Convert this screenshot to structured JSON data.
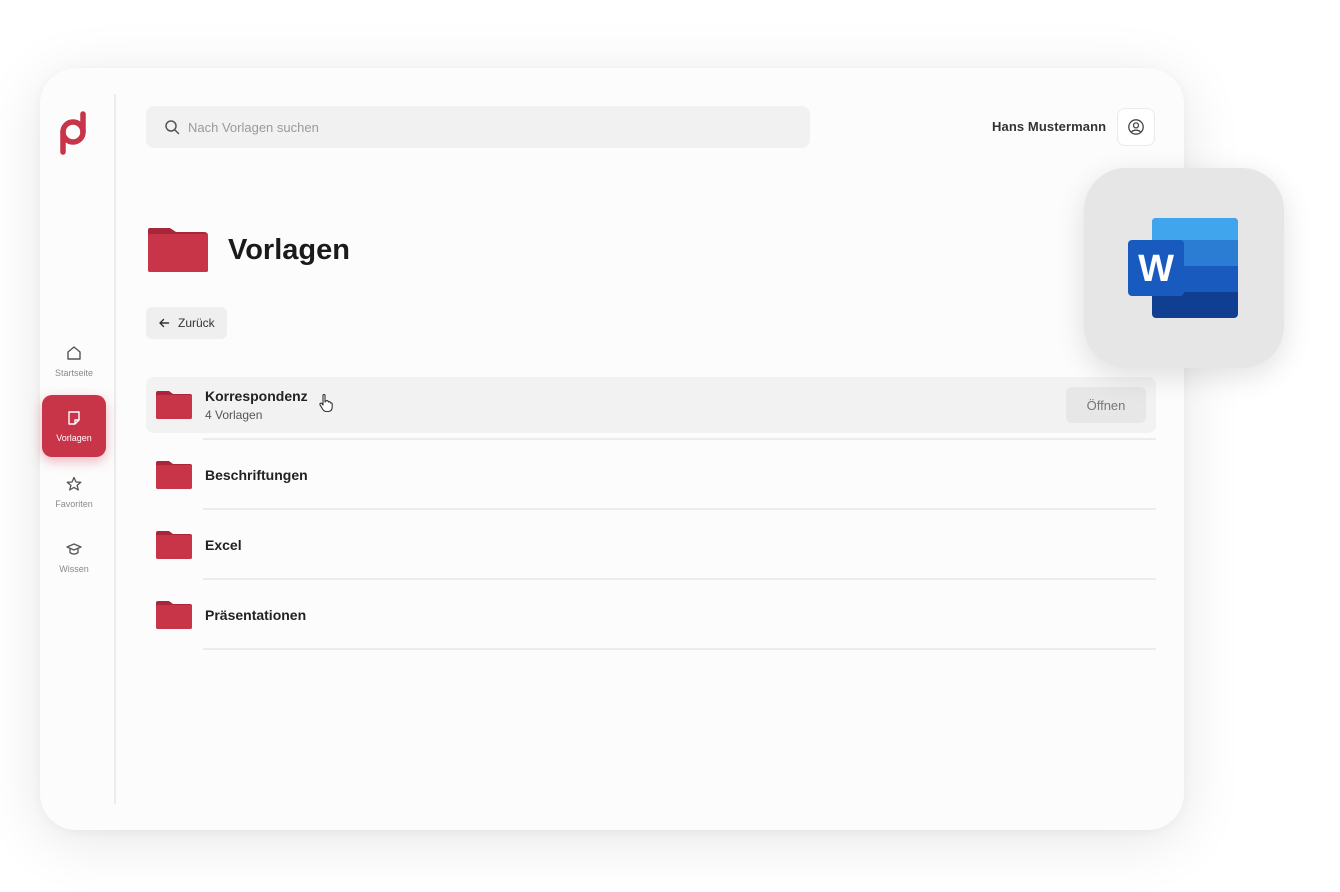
{
  "app": {
    "brand_color": "#c83448"
  },
  "sidebar": {
    "items": [
      {
        "label": "Startseite",
        "icon": "home-icon",
        "active": false
      },
      {
        "label": "Vorlagen",
        "icon": "template-icon",
        "active": true
      },
      {
        "label": "Favoriten",
        "icon": "star-icon",
        "active": false
      },
      {
        "label": "Wissen",
        "icon": "graduation-cap-icon",
        "active": false
      }
    ]
  },
  "header": {
    "search_placeholder": "Nach Vorlagen suchen",
    "user_name": "Hans Mustermann"
  },
  "page": {
    "title": "Vorlagen",
    "back_label": "Zurück"
  },
  "folders": [
    {
      "title": "Korrespondenz",
      "subtitle": "4 Vorlagen",
      "action_label": "Öffnen"
    },
    {
      "title": "Beschriftungen"
    },
    {
      "title": "Excel"
    },
    {
      "title": "Präsentationen"
    }
  ],
  "word_icon": {
    "letter": "W",
    "colors": [
      "#41a5ee",
      "#2b7cd3",
      "#185abd",
      "#103f91"
    ]
  }
}
